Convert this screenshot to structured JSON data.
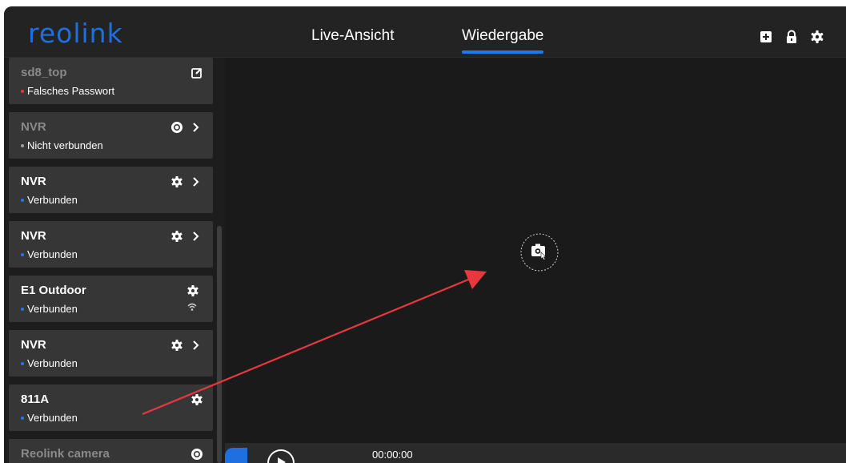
{
  "app": {
    "logo_text": "reolink",
    "brand_color": "#1e6fe0"
  },
  "header": {
    "tabs": [
      {
        "label": "Live-Ansicht",
        "active": false
      },
      {
        "label": "Wiedergabe",
        "active": true
      }
    ],
    "icons": [
      "add-device-icon",
      "lock-icon",
      "settings-gear-icon"
    ]
  },
  "sidebar": {
    "devices": [
      {
        "name": "sd8_top",
        "status": "Falsches Passwort",
        "status_color": "#e53935",
        "dim": true,
        "icon": "edit-icon",
        "chevron": false
      },
      {
        "name": "NVR",
        "status": "Nicht verbunden",
        "status_color": "#9e9e9e",
        "dim": true,
        "icon": "offline-icon",
        "chevron": true
      },
      {
        "name": "NVR",
        "status": "Verbunden",
        "status_color": "#1e7be8",
        "dim": false,
        "icon": "gear-icon",
        "chevron": true
      },
      {
        "name": "NVR",
        "status": "Verbunden",
        "status_color": "#1e7be8",
        "dim": false,
        "icon": "gear-icon",
        "chevron": true
      },
      {
        "name": "E1 Outdoor",
        "status": "Verbunden",
        "status_color": "#1e7be8",
        "dim": false,
        "icon": "gear-icon",
        "chevron": false,
        "wifi": true
      },
      {
        "name": "NVR",
        "status": "Verbunden",
        "status_color": "#1e7be8",
        "dim": false,
        "icon": "gear-icon",
        "chevron": true
      },
      {
        "name": "811A",
        "status": "Verbunden",
        "status_color": "#1e7be8",
        "dim": false,
        "icon": "gear-icon",
        "chevron": false
      },
      {
        "name": "Reolink camera",
        "status": "",
        "status_color": "#9e9e9e",
        "dim": true,
        "icon": "offline-icon",
        "chevron": false
      }
    ]
  },
  "player": {
    "time": "00:00:00",
    "annotation_arrow_color": "#e8383d"
  }
}
